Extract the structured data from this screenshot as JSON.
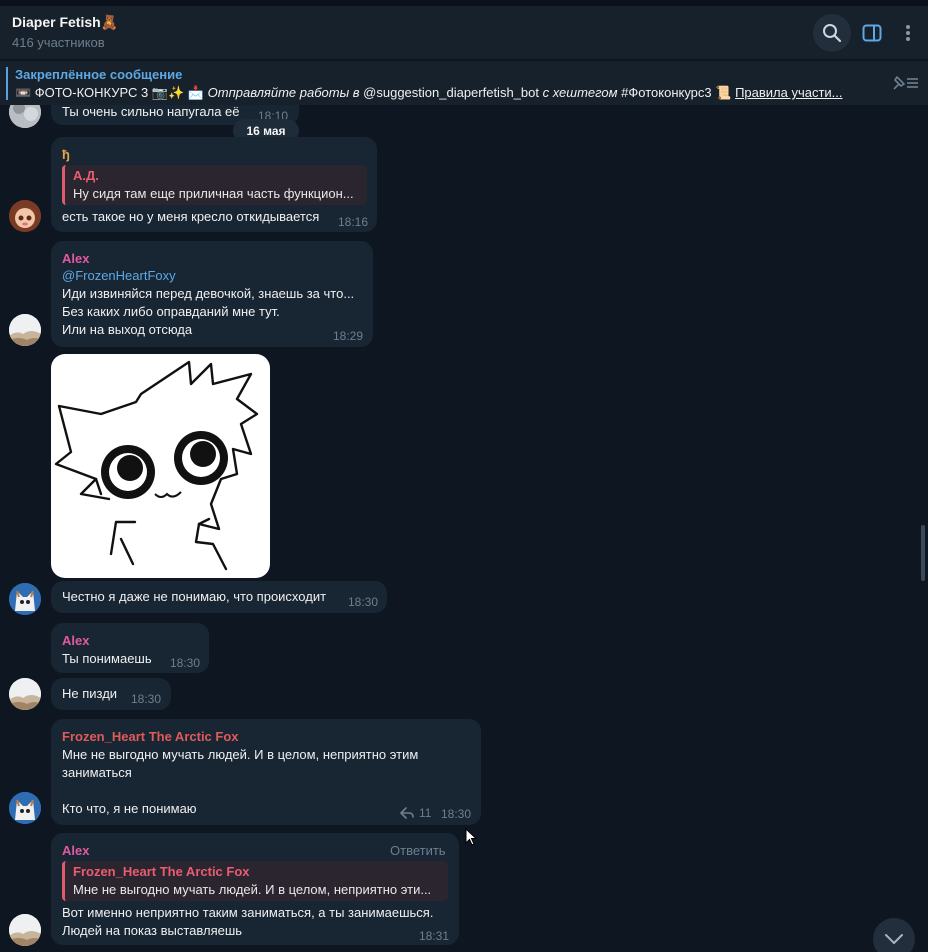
{
  "header": {
    "title": "Diaper Fetish🧸",
    "subtitle": "416 участников",
    "icons": [
      "search-icon",
      "sidebar-panel-icon",
      "more-vertical-icon"
    ]
  },
  "pinned": {
    "label": "Закреплённое сообщение",
    "emoji1": "📼",
    "text_part1": " ФОТО-КОНКУРС 3 📷✨ 📩 ",
    "text_italic1": "Отправляйте работы в",
    "text_part2": " @suggestion_diaperfetish_bot ",
    "text_italic2": "с хештегом",
    "text_part3": " #Фотоконкурс3 📜 ",
    "text_link": "Правила участи..."
  },
  "date_separator": "16 мая",
  "partial_message": {
    "text": "Ты очень сильно напугала её",
    "time": "18:10"
  },
  "messages": [
    {
      "sender": "ђ",
      "sender_color": "#e8a04a",
      "quote_name": "А.Д.",
      "quote_text": "Ну сидя там еще приличная часть функцион...",
      "text": "есть такое но у меня кресло откидывается",
      "time": "18:16"
    },
    {
      "sender": "Alex",
      "sender_color": "#e05aa0",
      "mention": "@FrozenHeartFoxy",
      "lines": [
        "Иди извиняйся перед девочкой, знаешь за что...",
        "Без каких либо оправданий мне тут.",
        "Или на выход отсюда"
      ],
      "time": "18:29"
    },
    {
      "text": "Честно я даже не понимаю, что происходит",
      "time": "18:30"
    },
    {
      "sender": "Alex",
      "sender_color": "#e05aa0",
      "text": "Ты понимаешь",
      "time": "18:30"
    },
    {
      "text": "Не пизди",
      "time": "18:30"
    },
    {
      "sender": "Frozen_Heart The Arctic Fox",
      "sender_color": "#e05a5a",
      "lines": [
        "Мне не выгодно мучать людей. И в целом, неприятно этим",
        "заниматься",
        "",
        "Кто что, я не понимаю"
      ],
      "replies": "11",
      "time": "18:30"
    },
    {
      "sender": "Alex",
      "sender_color": "#e05aa0",
      "reply_action": "Ответить",
      "quote_name": "Frozen_Heart The Arctic Fox",
      "quote_text": "Мне не выгодно мучать людей. И в целом, неприятно эти...",
      "lines": [
        "Вот именно неприятно таким заниматься, а ты занимаешься.",
        "Людей на показ выставляешь"
      ],
      "time": "18:31"
    }
  ],
  "colors": {
    "background": "#0e1621",
    "bubble": "#182533",
    "header": "#17212b",
    "accent": "#5ea8e3",
    "time": "#6d7f8f"
  }
}
